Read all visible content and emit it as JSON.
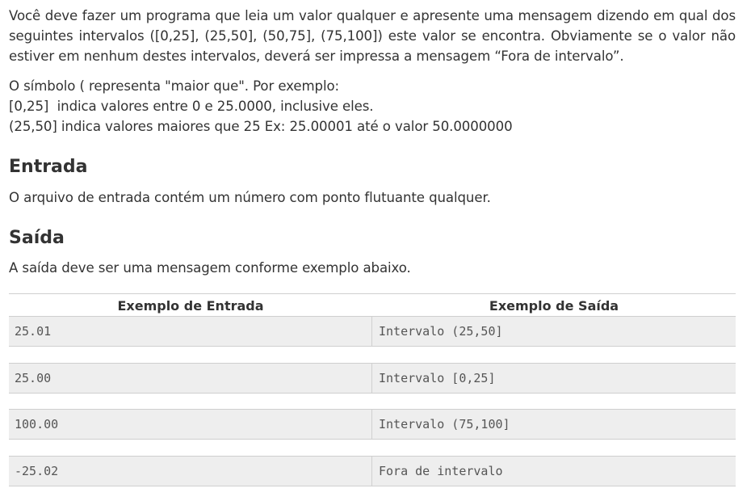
{
  "intro": "Você deve fazer um programa que leia um valor qualquer e apresente uma mensagem dizendo em qual dos seguintes intervalos ([0,25], (25,50], (50,75], (75,100]) este valor se encontra. Obviamente se o valor não estiver em nenhum destes intervalos, deverá ser impressa a mensagem “Fora de intervalo”.",
  "symbols": [
    "O símbolo ( representa \"maior que\". Por exemplo:",
    "[0,25]  indica valores entre 0 e 25.0000, inclusive eles.",
    "(25,50] indica valores maiores que 25 Ex: 25.00001 até o valor 50.0000000"
  ],
  "entrada": {
    "heading": "Entrada",
    "text": "O arquivo de entrada contém um número com ponto flutuante qualquer."
  },
  "saida": {
    "heading": "Saída",
    "text": "A saída deve ser uma mensagem conforme exemplo abaixo."
  },
  "examples": {
    "input_header": "Exemplo de Entrada",
    "output_header": "Exemplo de Saída",
    "rows": [
      {
        "input": "25.01",
        "output": "Intervalo (25,50]"
      },
      {
        "input": "25.00",
        "output": "Intervalo [0,25]"
      },
      {
        "input": "100.00",
        "output": "Intervalo (75,100]"
      },
      {
        "input": "-25.02",
        "output": "Fora de intervalo"
      }
    ]
  }
}
